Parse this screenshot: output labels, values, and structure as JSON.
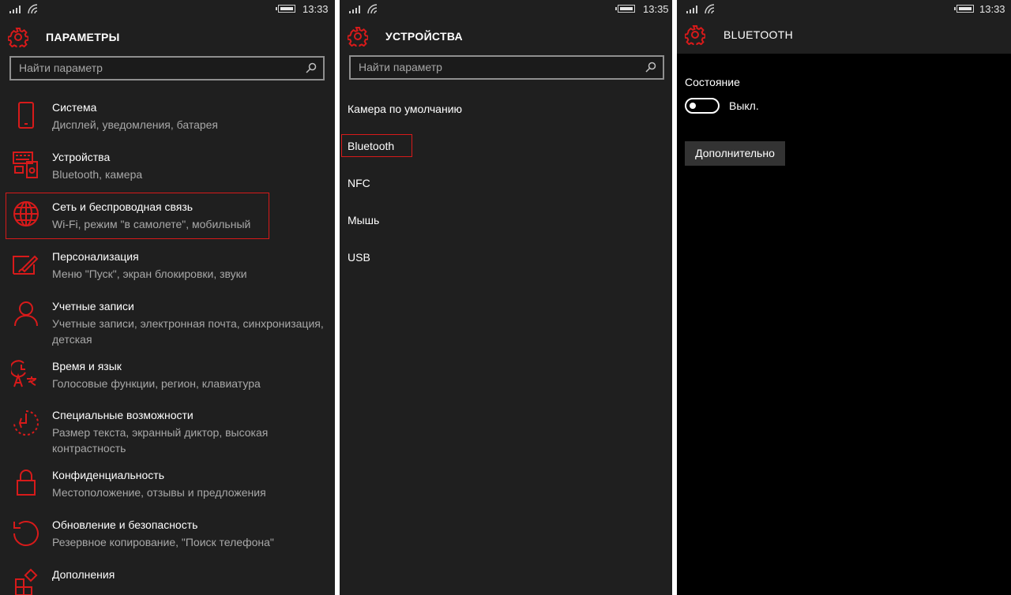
{
  "screen1": {
    "time": "13:33",
    "title": "ПАРАМЕТРЫ",
    "search_placeholder": "Найти параметр",
    "items": [
      {
        "title": "Система",
        "subtitle": "Дисплей, уведомления, батарея",
        "icon": "phone-icon"
      },
      {
        "title": "Устройства",
        "subtitle": "Bluetooth, камера",
        "icon": "devices-icon"
      },
      {
        "title": "Сеть и беспроводная связь",
        "subtitle": "Wi-Fi, режим \"в самолете\", мобильный",
        "icon": "globe-icon"
      },
      {
        "title": "Персонализация",
        "subtitle": "Меню \"Пуск\", экран блокировки, звуки",
        "icon": "paintbrush-icon"
      },
      {
        "title": "Учетные записи",
        "subtitle": "Учетные записи, электронная почта, синхронизация, детская",
        "icon": "person-icon"
      },
      {
        "title": "Время и язык",
        "subtitle": "Голосовые функции, регион, клавиатура",
        "icon": "time-language-icon"
      },
      {
        "title": "Специальные возможности",
        "subtitle": "Размер текста, экранный диктор, высокая контрастность",
        "icon": "accessibility-icon"
      },
      {
        "title": "Конфиденциальность",
        "subtitle": "Местоположение, отзывы и предложения",
        "icon": "lock-icon"
      },
      {
        "title": "Обновление и безопасность",
        "subtitle": "Резервное копирование, \"Поиск телефона\"",
        "icon": "update-icon"
      },
      {
        "title": "Дополнения",
        "subtitle": "",
        "icon": "extras-icon"
      }
    ]
  },
  "screen2": {
    "time": "13:35",
    "title": "УСТРОЙСТВА",
    "search_placeholder": "Найти параметр",
    "items": [
      "Камера по умолчанию",
      "Bluetooth",
      "NFC",
      "Мышь",
      "USB"
    ]
  },
  "screen3": {
    "time": "13:33",
    "title": "BLUETOOTH",
    "state_label": "Состояние",
    "toggle_text": "Выкл.",
    "advanced_button": "Дополнительно"
  },
  "colors": {
    "accent": "#d71a1a",
    "background": "#1f1f1f",
    "text_secondary": "#a8a8a8"
  }
}
